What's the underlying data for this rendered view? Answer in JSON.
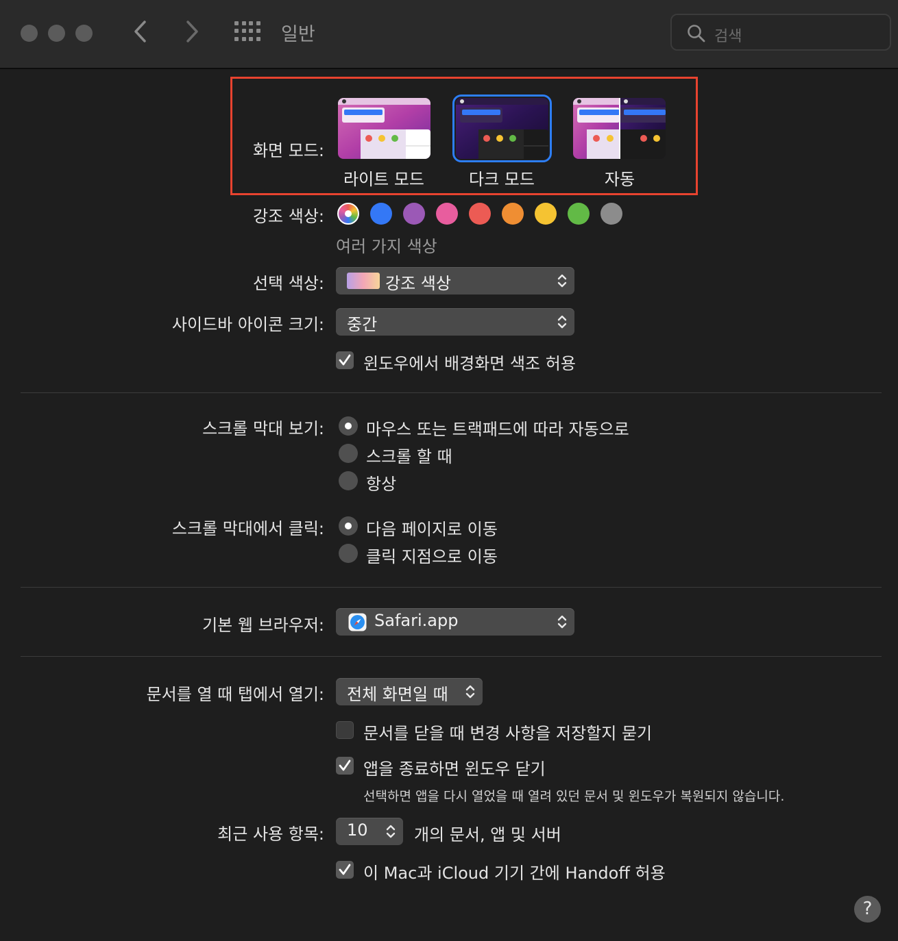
{
  "window": {
    "title": "일반",
    "search_placeholder": "검색"
  },
  "appearance": {
    "label": "화면 모드:",
    "options": [
      "라이트 모드",
      "다크 모드",
      "자동"
    ],
    "selected": "다크 모드"
  },
  "accent": {
    "label": "강조 색상:",
    "caption": "여러 가지 색상",
    "colors": [
      "multicolor",
      "#3478f6",
      "#9b59b6",
      "#e85d9e",
      "#ec5b54",
      "#ef8e33",
      "#f5c332",
      "#62ba46",
      "#8c8c8c"
    ]
  },
  "highlight": {
    "label": "선택 색상:",
    "value": "강조 색상"
  },
  "sidebar_icon_size": {
    "label": "사이드바 아이콘 크기:",
    "value": "중간"
  },
  "wallpaper_tinting": {
    "label": "윈도우에서 배경화면 색조 허용",
    "checked": true
  },
  "show_scroll_bars": {
    "label": "스크롤 막대 보기:",
    "options": [
      "마우스 또는 트랙패드에 따라 자동으로",
      "스크롤 할 때",
      "항상"
    ],
    "selected_index": 0
  },
  "click_scroll_bar": {
    "label": "스크롤 막대에서 클릭:",
    "options": [
      "다음 페이지로 이동",
      "클릭 지점으로 이동"
    ],
    "selected_index": 0
  },
  "default_browser": {
    "label": "기본 웹 브라우저:",
    "value": "Safari.app"
  },
  "prefer_tabs": {
    "label": "문서를 열 때 탭에서 열기:",
    "value": "전체 화면일 때"
  },
  "ask_keep_changes": {
    "label": "문서를 닫을 때 변경 사항을 저장할지 묻기",
    "checked": false
  },
  "close_windows": {
    "label": "앱을 종료하면 윈도우 닫기",
    "checked": true,
    "description": "선택하면 앱을 다시 열었을 때 열려 있던 문서 및 윈도우가 복원되지 않습니다."
  },
  "recent_items": {
    "label": "최근 사용 항목:",
    "value": "10",
    "suffix": "개의 문서, 앱 및 서버"
  },
  "handoff": {
    "label": "이 Mac과 iCloud 기기 간에 Handoff 허용",
    "checked": true
  },
  "help": {
    "symbol": "?"
  }
}
